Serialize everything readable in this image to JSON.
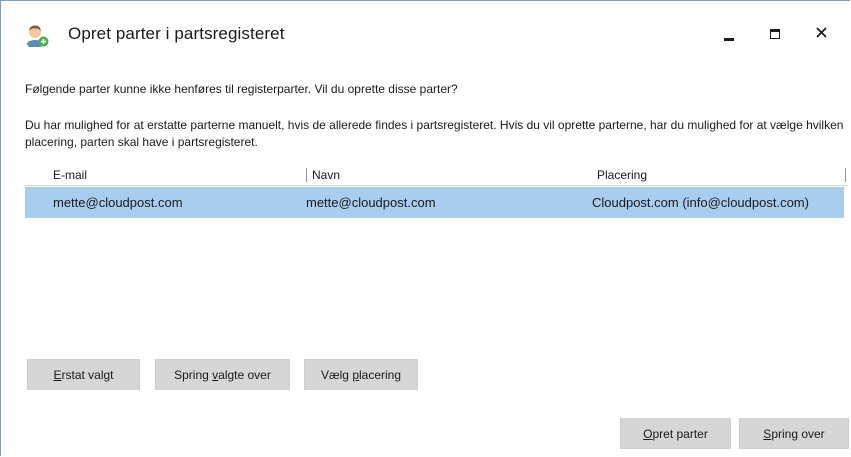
{
  "window": {
    "title": "Opret parter i partsregisteret",
    "icon": "user-add-icon"
  },
  "messages": {
    "line1": "Følgende parter kunne ikke henføres til registerparter. Vil du oprette disse parter?",
    "line2": "Du har mulighed for at erstatte parterne manuelt, hvis de allerede findes i partsregisteret. Hvis du vil oprette parterne, har du mulighed for at vælge hvilken placering, parten skal have i partsregisteret."
  },
  "grid": {
    "columns": [
      "E-mail",
      "Navn",
      "Placering"
    ],
    "rows": [
      {
        "email": "mette@cloudpost.com",
        "name": "mette@cloudpost.com",
        "placement": "Cloudpost.com (info@cloudpost.com)",
        "selected": true
      }
    ]
  },
  "actions": {
    "replace": {
      "underline": "E",
      "rest": "rstat valgt"
    },
    "skip_selected": {
      "pre": "Spring ",
      "underline": "v",
      "rest": "algte over"
    },
    "choose_placement": {
      "pre": "Vælg ",
      "underline": "p",
      "rest": "lacering"
    }
  },
  "footer": {
    "create": {
      "underline": "O",
      "rest": "pret parter"
    },
    "skip": {
      "underline": "S",
      "rest": "pring over"
    }
  },
  "colors": {
    "selection": "#a9cdee",
    "button_bg": "#d6d6d6",
    "window_border": "#7a9cc6"
  }
}
